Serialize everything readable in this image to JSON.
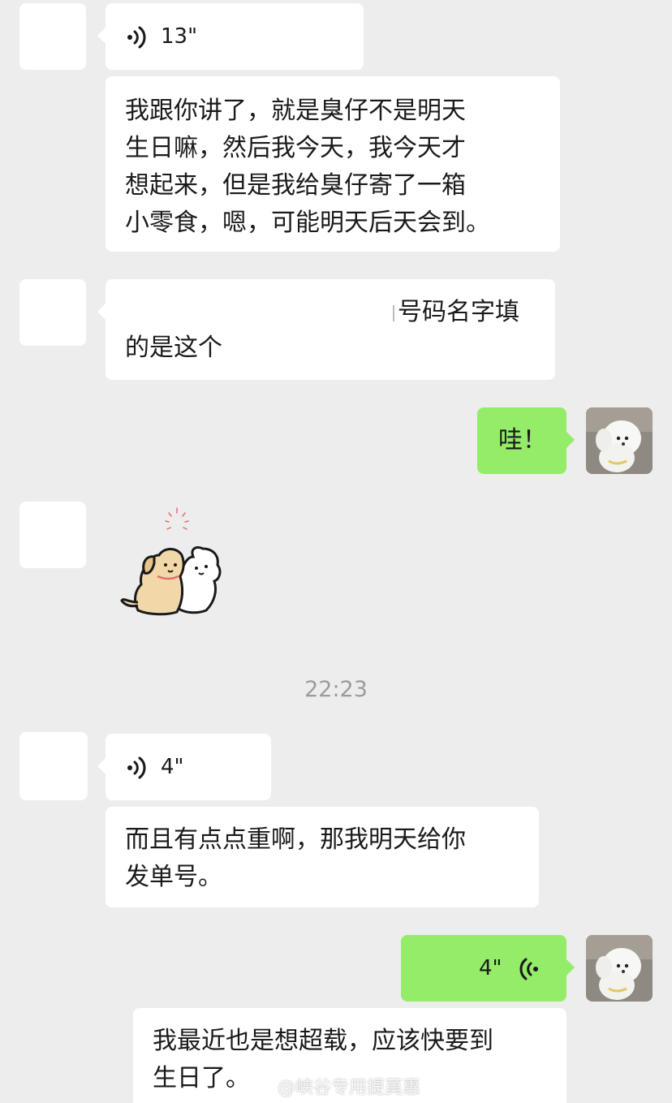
{
  "messages": {
    "m1_voice_duration": "13\"",
    "m2_text_lines": [
      "我跟你讲了，就是臭仔不是明天",
      "生日嘛，然后我今天，我今天才",
      "想起来，但是我给臭仔寄了一箱",
      "小零食，嗯，可能明天后天会到。"
    ],
    "m3_text_line1": "号码名字填",
    "m3_text_line2": "的是这个",
    "m4_text": "哇！",
    "m5_voice_duration": "4\"",
    "m6_text_lines": [
      "而且有点点重啊，那我明天给你",
      "发单号。"
    ],
    "m7_voice_duration": "4\"",
    "m8_text_lines": [
      "我最近也是想超载，应该快要到",
      "生日了。"
    ]
  },
  "timestamp": "22:23",
  "watermark": "@峡谷专用提莫惠",
  "icons": {
    "voice_left": "voice-wave-icon",
    "voice_right": "voice-wave-icon",
    "sticker": "dog-cat-hug-sticker",
    "self_avatar": "white-poodle-avatar"
  },
  "colors": {
    "background": "#ededed",
    "bubble_in": "#ffffff",
    "bubble_out": "#95ec69",
    "timestamp": "#9b9b9b"
  }
}
